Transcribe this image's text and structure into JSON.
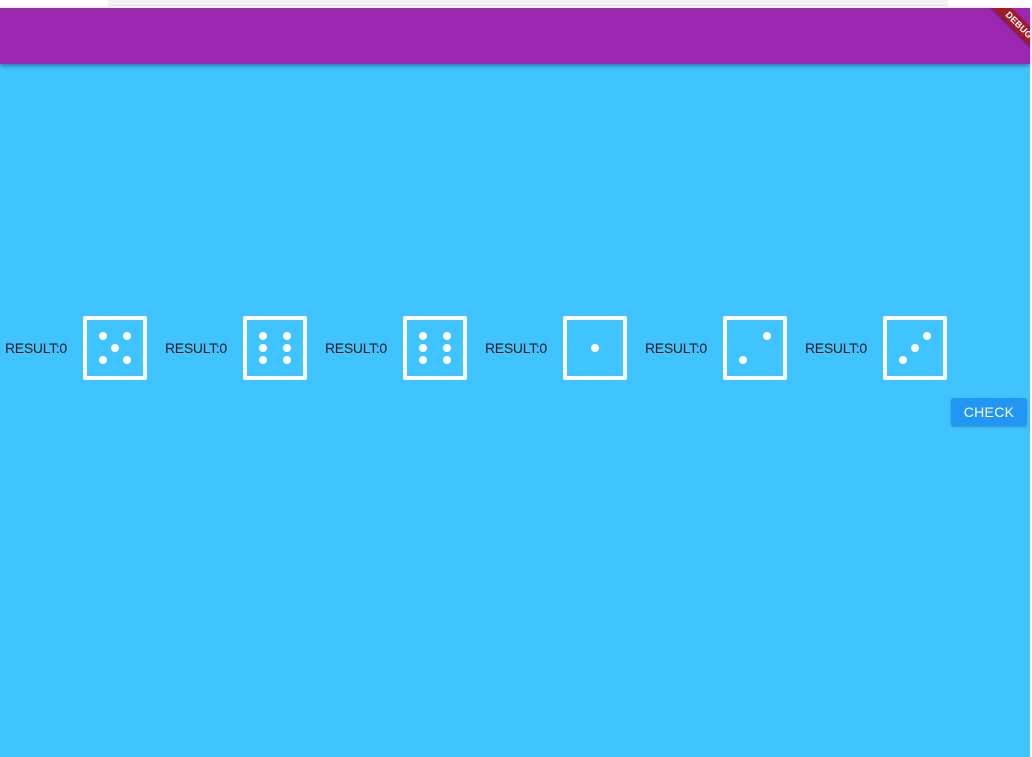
{
  "debug_banner": {
    "label": "DEBUG"
  },
  "dice_row": [
    {
      "result_label": "RESULT:0",
      "die_face": 5
    },
    {
      "result_label": "RESULT:0",
      "die_face": 6
    },
    {
      "result_label": "RESULT:0",
      "die_face": 6
    },
    {
      "result_label": "RESULT:0",
      "die_face": 1
    },
    {
      "result_label": "RESULT:0",
      "die_face": 2
    },
    {
      "result_label": "RESULT:0",
      "die_face": 3
    }
  ],
  "check_button": {
    "label": "CHECK"
  },
  "colors": {
    "appbar": "#9c27b0",
    "background": "#40c4ff",
    "button": "#2196f3",
    "debug_ribbon": "#a01c28"
  }
}
